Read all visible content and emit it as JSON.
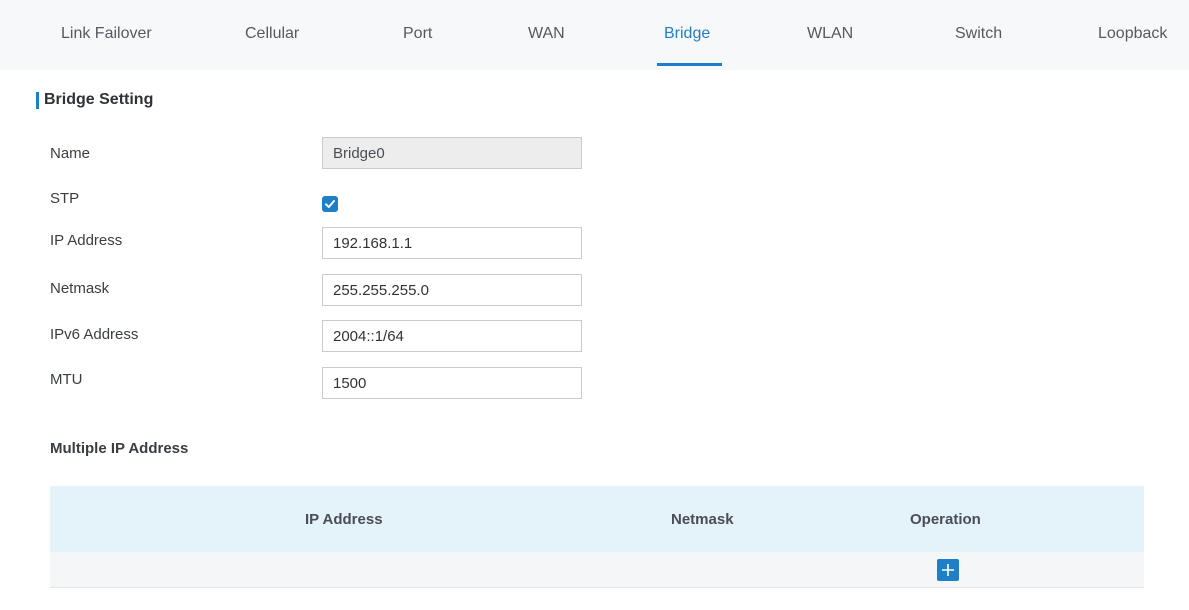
{
  "tabs": [
    {
      "label": "Link Failover",
      "active": false
    },
    {
      "label": "Cellular",
      "active": false
    },
    {
      "label": "Port",
      "active": false
    },
    {
      "label": "WAN",
      "active": false
    },
    {
      "label": "Bridge",
      "active": true
    },
    {
      "label": "WLAN",
      "active": false
    },
    {
      "label": "Switch",
      "active": false
    },
    {
      "label": "Loopback",
      "active": false
    }
  ],
  "section": {
    "title": "Bridge Setting"
  },
  "form": {
    "name": {
      "label": "Name",
      "value": "Bridge0",
      "disabled": true
    },
    "stp": {
      "label": "STP",
      "checked": true
    },
    "ip_address": {
      "label": "IP Address",
      "value": "192.168.1.1"
    },
    "netmask": {
      "label": "Netmask",
      "value": "255.255.255.0"
    },
    "ipv6_address": {
      "label": "IPv6 Address",
      "value": "2004::1/64"
    },
    "mtu": {
      "label": "MTU",
      "value": "1500"
    }
  },
  "multiple_ip": {
    "title": "Multiple IP Address",
    "columns": [
      "IP Address",
      "Netmask",
      "Operation"
    ],
    "rows": [],
    "add_icon": "plus-icon"
  },
  "colors": {
    "accent": "#1f7fc6",
    "table_header_bg": "#e4f2fa"
  }
}
